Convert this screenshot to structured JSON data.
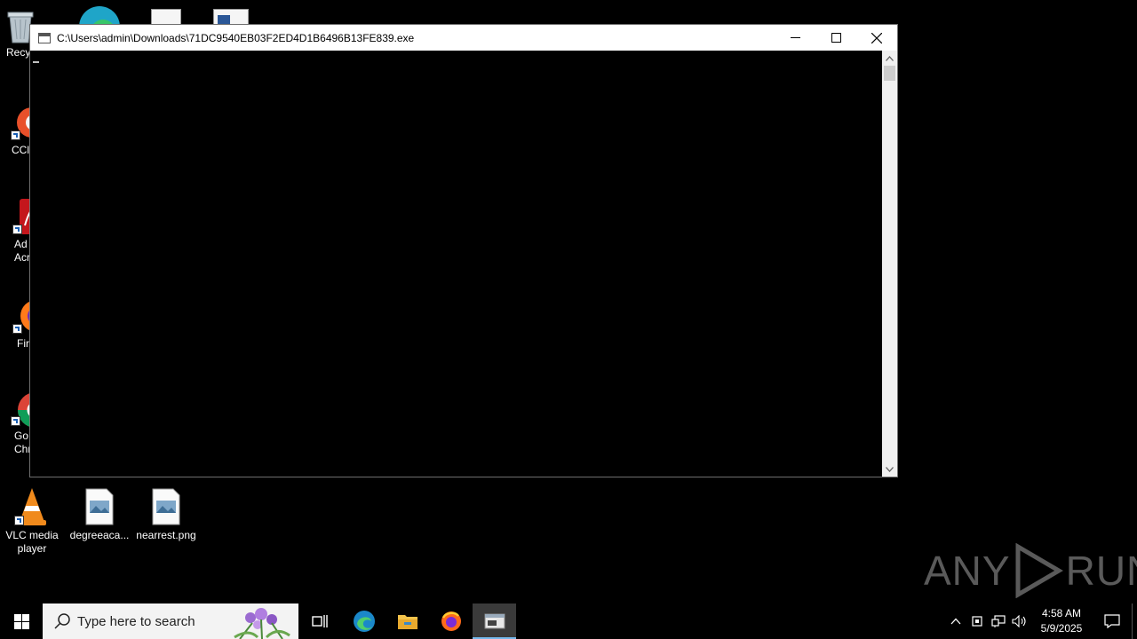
{
  "desktop": {
    "icons": [
      {
        "label": "Recy"
      },
      {
        "label": "CCl"
      },
      {
        "label": "Ad\nAcr"
      },
      {
        "label": "Fir"
      },
      {
        "label": "Go\nChr"
      },
      {
        "label": "VLC media player"
      },
      {
        "label": "degreeaca..."
      },
      {
        "label": "nearrest.png"
      }
    ]
  },
  "console_window": {
    "title": "C:\\Users\\admin\\Downloads\\71DC9540EB03F2ED4D1B6496B13FE839.exe",
    "icons": {
      "minimize": "minimize-icon",
      "maximize": "maximize-icon",
      "close": "close-icon"
    }
  },
  "watermark": {
    "text_left": "ANY",
    "text_right": "RUN"
  },
  "taskbar": {
    "search_placeholder": "Type here to search",
    "pinned": [
      "task-view",
      "edge",
      "file-explorer",
      "firefox",
      "console"
    ],
    "clock": {
      "time": "4:58 AM",
      "date": "5/9/2025"
    }
  },
  "colors": {
    "taskbar": "#000000",
    "accent": "#76b9ed",
    "search_bg": "#f3f3f3"
  }
}
